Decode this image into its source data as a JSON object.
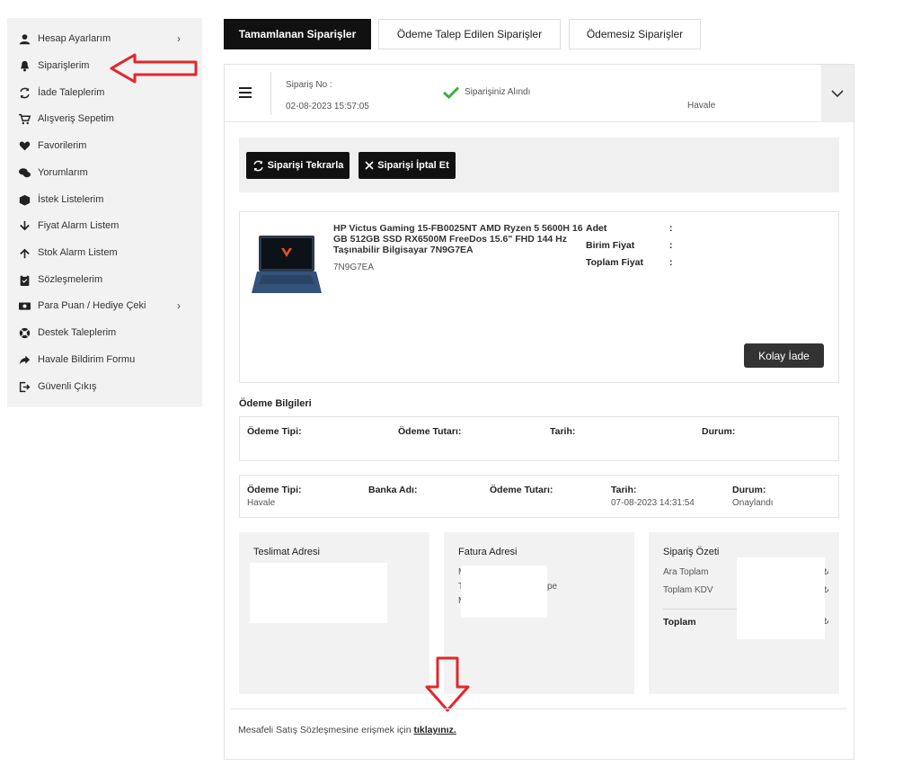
{
  "sidebar": {
    "items": [
      {
        "label": "Hesap Ayarlarım",
        "icon": "user-icon",
        "chevron": "›"
      },
      {
        "label": "Siparişlerim",
        "icon": "bell-icon"
      },
      {
        "label": "İade Taleplerim",
        "icon": "refresh-icon"
      },
      {
        "label": "Alışveriş Sepetim",
        "icon": "cart-icon"
      },
      {
        "label": "Favorilerim",
        "icon": "heart-icon"
      },
      {
        "label": "Yorumlarım",
        "icon": "comments-icon"
      },
      {
        "label": "İstek Listelerim",
        "icon": "box-icon"
      },
      {
        "label": "Fiyat Alarm Listem",
        "icon": "arrow-down-icon"
      },
      {
        "label": "Stok Alarm Listem",
        "icon": "arrow-up-icon"
      },
      {
        "label": "Sözleşmelerim",
        "icon": "clipboard-icon"
      },
      {
        "label": "Para Puan / Hediye Çeki",
        "icon": "money-icon",
        "chevron": "›"
      },
      {
        "label": "Destek Taleplerim",
        "icon": "lifebuoy-icon"
      },
      {
        "label": "Havale Bildirim Formu",
        "icon": "share-arrow-icon"
      },
      {
        "label": "Güvenli Çıkış",
        "icon": "logout-icon"
      }
    ]
  },
  "tabs": [
    {
      "label": "Tamamlanan Siparişler",
      "active": true
    },
    {
      "label": "Ödeme Talep Edilen Siparişler"
    },
    {
      "label": "Ödemesiz Siparişler"
    }
  ],
  "order": {
    "no_label": "Sipariş No :",
    "date": "02-08-2023 15:57:05",
    "status": "Siparişiniz Alındı",
    "payment_method": "Havale",
    "repeat_button": "Siparişi Tekrarla",
    "cancel_button": "Siparişi İptal Et"
  },
  "product": {
    "title": "HP Victus Gaming 15-FB0025NT AMD Ryzen 5 5600H 16 GB 512GB SSD RX6500M FreeDos 15.6\" FHD 144 Hz Taşınabilir Bilgisayar 7N9G7EA",
    "code": "7N9G7EA",
    "adet_label": "Adet",
    "birim_label": "Birim Fiyat",
    "toplam_label": "Toplam Fiyat",
    "colon": ":",
    "return_button": "Kolay İade"
  },
  "payment": {
    "title": "Ödeme Bilgileri",
    "row1": {
      "tip": "Ödeme Tipi:",
      "tutar": "Ödeme Tutarı:",
      "tarih": "Tarih:",
      "durum": "Durum:"
    },
    "row2": {
      "tip": "Ödeme Tipi:",
      "tip_val": "Havale",
      "banka": "Banka Adı:",
      "tutar": "Ödeme Tutarı:",
      "tarih": "Tarih:",
      "tarih_val": "07-08-2023 14:31:54",
      "durum": "Durum:",
      "durum_val": "Onaylandı"
    }
  },
  "addresses": {
    "delivery": "Teslimat Adresi",
    "invoice": "Fatura Adresi",
    "invoice_fragments": {
      "a": "M",
      "b": "T",
      "c": "M",
      "d": "pe"
    },
    "summary": "Sipariş Özeti",
    "subtotal": "Ara Toplam",
    "vat": "Toplam KDV",
    "total": "Toplam",
    "summary_fragments": {
      "a": "₺",
      "b": "₺",
      "c": "₺"
    }
  },
  "footer": {
    "text": "Mesafeli Satış Sözleşmesine erişmek için",
    "link": "tıklayınız."
  },
  "colors": {
    "accent": "#111111",
    "annotation": "#e3262b",
    "check": "#3cb043"
  }
}
